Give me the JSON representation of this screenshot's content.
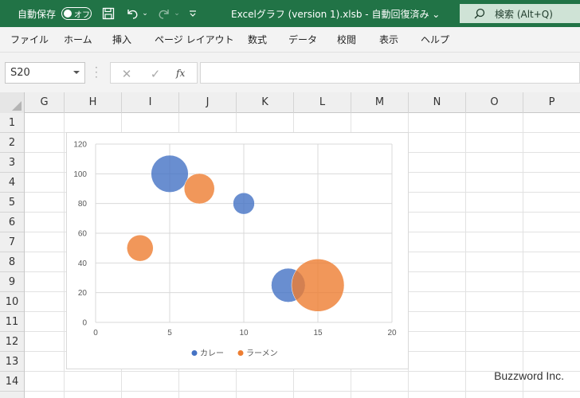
{
  "titlebar": {
    "autosave_label": "自動保存",
    "toggle_text": "オフ",
    "file_title": "Excelグラフ (version 1).xlsb  -  自動回復済み ⌄",
    "search_label": "検索 (Alt+Q)"
  },
  "menu": {
    "items": [
      "ファイル",
      "ホーム",
      "挿入",
      "ページ レイアウト",
      "数式",
      "データ",
      "校閲",
      "表示",
      "ヘルプ"
    ]
  },
  "formula_bar": {
    "name_box": "S20",
    "fx_label": "fx",
    "formula_value": ""
  },
  "sheet": {
    "columns": [
      "G",
      "H",
      "I",
      "J",
      "K",
      "L",
      "M",
      "N",
      "O",
      "P"
    ],
    "rows": [
      "1",
      "2",
      "3",
      "4",
      "5",
      "6",
      "7",
      "8",
      "9",
      "10",
      "11",
      "12",
      "13",
      "14"
    ]
  },
  "chart_data": {
    "type": "bubble",
    "title": "",
    "xlim": [
      0,
      20
    ],
    "ylim": [
      0,
      120
    ],
    "x_ticks": [
      "0",
      "5",
      "10",
      "15",
      "20"
    ],
    "y_ticks": [
      "0",
      "20",
      "40",
      "60",
      "80",
      "100",
      "120"
    ],
    "grid": true,
    "legend_position": "bottom",
    "series": [
      {
        "name": "カレー",
        "color": "#4472C4",
        "points": [
          {
            "x": 5,
            "y": 100,
            "size": 3
          },
          {
            "x": 10,
            "y": 80,
            "size": 1
          },
          {
            "x": 13,
            "y": 25,
            "size": 2.5
          }
        ]
      },
      {
        "name": "ラーメン",
        "color": "#ED7D31",
        "points": [
          {
            "x": 7,
            "y": 90,
            "size": 2
          },
          {
            "x": 3,
            "y": 50,
            "size": 1.5
          },
          {
            "x": 15,
            "y": 25,
            "size": 6
          }
        ]
      }
    ]
  },
  "watermark": "Buzzword Inc."
}
